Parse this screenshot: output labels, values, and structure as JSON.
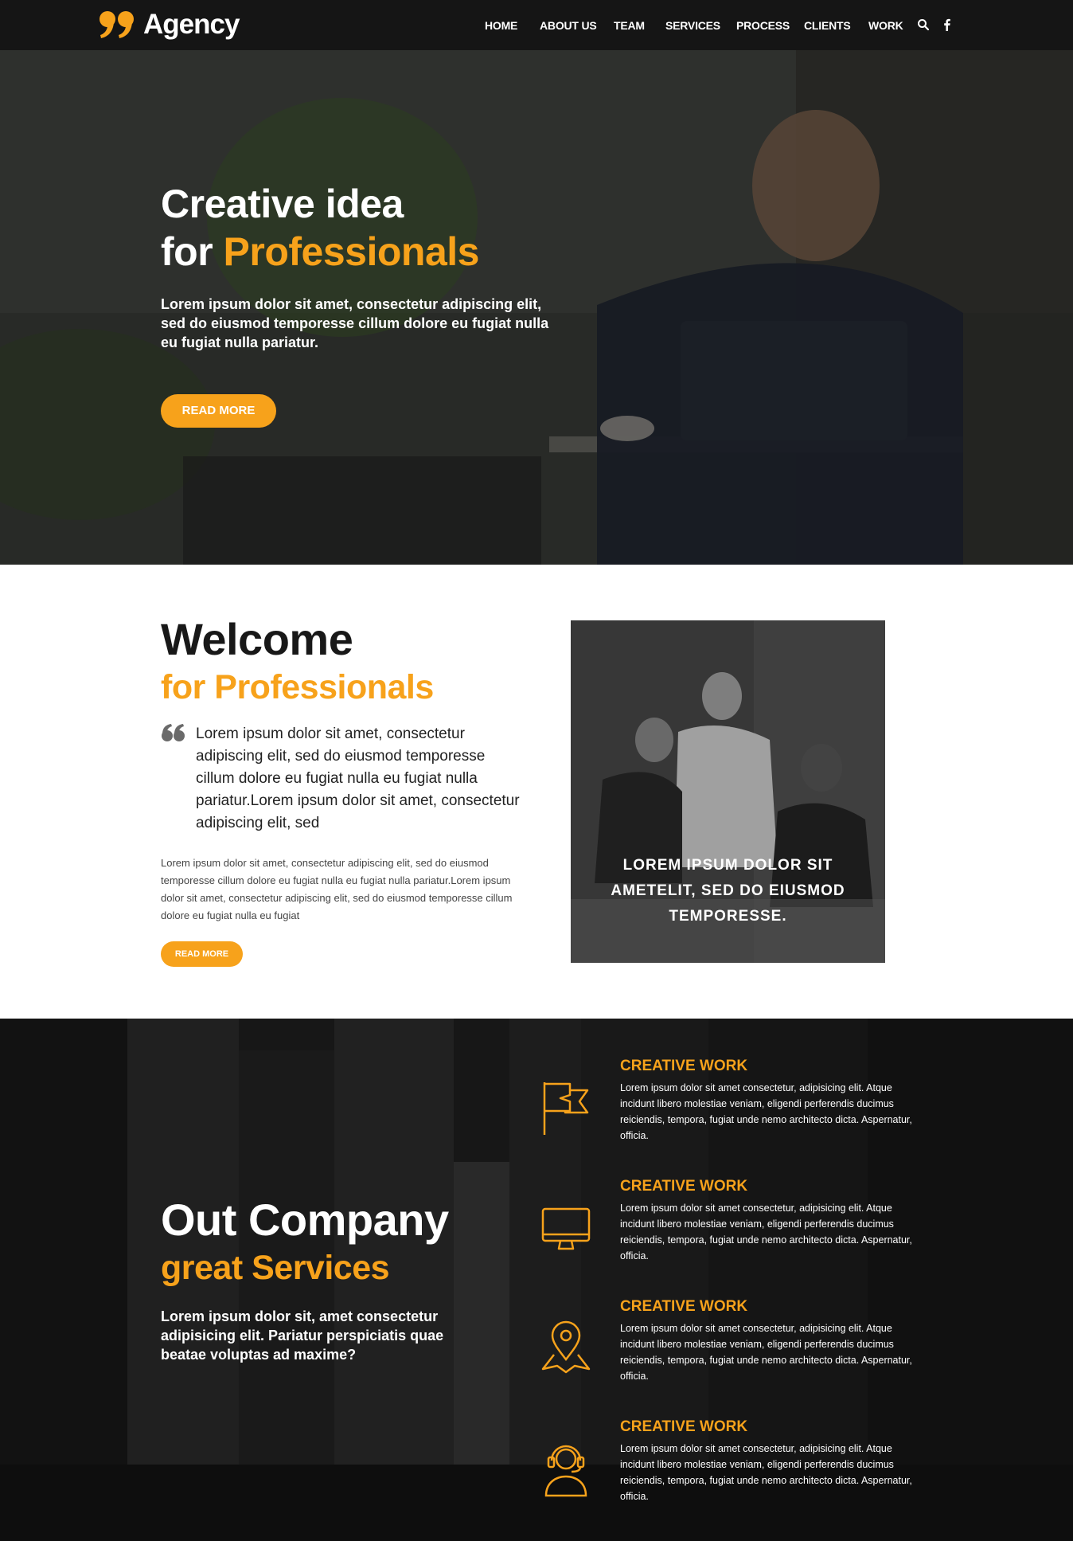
{
  "brand": {
    "name": "Agency",
    "accent_color": "#f7a21b",
    "logo_icon": "quote-mark-logo"
  },
  "nav": {
    "items": [
      "HOME",
      "ABOUT US",
      "TEAM",
      "SERVICES",
      "PROCESS",
      "CLIENTS",
      "WORK"
    ],
    "icons": [
      "search-icon",
      "facebook-icon"
    ]
  },
  "hero": {
    "title_line1": "Creative idea",
    "title_for": "for ",
    "title_accent": "Professionals",
    "text": "Lorem ipsum dolor sit amet, consectetur adipiscing elit, sed do eiusmod temporesse cillum dolore eu fugiat nulla eu fugiat nulla pariatur.",
    "button": "READ MORE"
  },
  "welcome": {
    "title": "Welcome",
    "subtitle": "for Professionals",
    "quote": "Lorem ipsum dolor sit amet, consectetur adipiscing elit, sed do eiusmod temporesse cillum dolore eu fugiat nulla eu fugiat nulla pariatur.Lorem ipsum dolor sit amet, consectetur adipiscing elit, sed",
    "body": "Lorem ipsum dolor sit amet, consectetur adipiscing elit, sed do eiusmod temporesse cillum dolore eu fugiat nulla eu fugiat nulla pariatur.Lorem ipsum dolor sit amet, consectetur adipiscing elit, sed do eiusmod temporesse cillum dolore eu fugiat nulla eu fugiat",
    "button": "READ MORE",
    "image_caption": "LOREM IPSUM DOLOR SIT AMETELIT, SED DO EIUSMOD TEMPORESSE."
  },
  "services": {
    "title": "Out Company",
    "subtitle": "great Services",
    "text": "Lorem ipsum dolor sit, amet consectetur adipisicing elit. Pariatur perspiciatis quae beatae voluptas ad maxime?",
    "items": [
      {
        "icon": "flag-icon",
        "title": "CREATIVE WORK",
        "desc": "Lorem ipsum dolor sit amet consectetur, adipisicing elit. Atque incidunt libero molestiae veniam, eligendi perferendis ducimus reiciendis, tempora, fugiat unde nemo architecto dicta. Aspernatur, officia."
      },
      {
        "icon": "monitor-icon",
        "title": "CREATIVE WORK",
        "desc": "Lorem ipsum dolor sit amet consectetur, adipisicing elit. Atque incidunt libero molestiae veniam, eligendi perferendis ducimus reiciendis, tempora, fugiat unde nemo architecto dicta. Aspernatur, officia."
      },
      {
        "icon": "map-pin-icon",
        "title": "CREATIVE WORK",
        "desc": "Lorem ipsum dolor sit amet consectetur, adipisicing elit. Atque incidunt libero molestiae veniam, eligendi perferendis ducimus reiciendis, tempora, fugiat unde nemo architecto dicta. Aspernatur, officia."
      },
      {
        "icon": "headset-icon",
        "title": "CREATIVE WORK",
        "desc": "Lorem ipsum dolor sit amet consectetur, adipisicing elit. Atque incidunt libero molestiae veniam, eligendi perferendis ducimus reiciendis, tempora, fugiat unde nemo architecto dicta. Aspernatur, officia."
      }
    ]
  }
}
